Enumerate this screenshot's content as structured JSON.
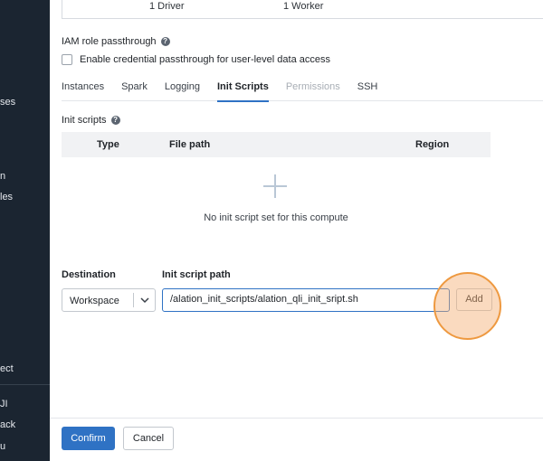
{
  "sidebar": {
    "fragments": [
      "ses",
      "n",
      "les",
      "ect",
      "JI",
      "ack",
      "u"
    ]
  },
  "summary": {
    "driver": "1 Driver",
    "worker": "1 Worker"
  },
  "iam": {
    "title": "IAM role passthrough",
    "checkbox_label": "Enable credential passthrough for user-level data access",
    "checked": false
  },
  "tabs": [
    {
      "label": "Instances",
      "state": "normal"
    },
    {
      "label": "Spark",
      "state": "normal"
    },
    {
      "label": "Logging",
      "state": "normal"
    },
    {
      "label": "Init Scripts",
      "state": "active"
    },
    {
      "label": "Permissions",
      "state": "disabled"
    },
    {
      "label": "SSH",
      "state": "normal"
    }
  ],
  "init_scripts": {
    "label": "Init scripts",
    "columns": [
      "Type",
      "File path",
      "Region"
    ],
    "empty_text": "No init script set for this compute"
  },
  "form": {
    "destination_label": "Destination",
    "destination_value": "Workspace",
    "path_label": "Init script path",
    "path_value": "/alation_init_scripts/alation_qli_init_sript.sh",
    "add_label": "Add"
  },
  "footer": {
    "confirm_label": "Confirm",
    "cancel_label": "Cancel"
  },
  "colors": {
    "accent": "#2f72c4",
    "sidebar_bg": "#1b2531",
    "highlight": "#ee9940"
  }
}
